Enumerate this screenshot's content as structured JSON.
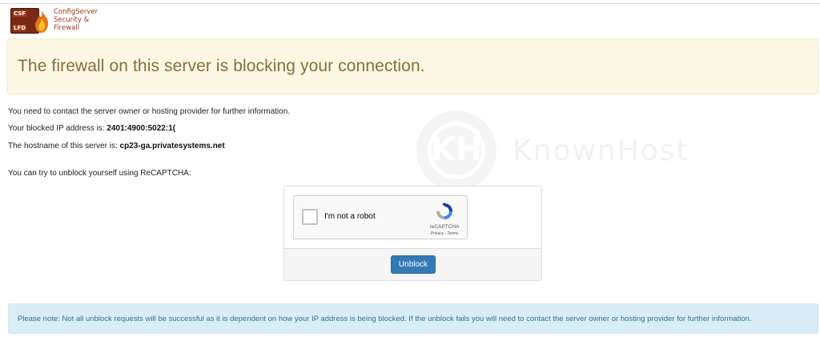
{
  "logo": {
    "box_tag_top": "CSF",
    "box_tag_bottom": "LFD",
    "line1": "ConfigServer",
    "line2": "Security &",
    "line3": "Firewall"
  },
  "banner": {
    "heading": "The firewall on this server is blocking your connection."
  },
  "content": {
    "contact_text": "You need to contact the server owner or hosting provider for further information.",
    "ip_label": "Your blocked IP address is: ",
    "ip_value": "2401:4900:5022:1(",
    "hostname_label": "The hostname of this server is: ",
    "hostname_value": "cp23-ga.privatesystems.net",
    "unblock_prompt": "You can try to unblock yourself using ReCAPTCHA:"
  },
  "watermark": {
    "mark": "KH",
    "text": "KnownHost"
  },
  "recaptcha": {
    "checkbox_label": "I'm not a robot",
    "brand": "reCAPTCHA",
    "terms": "Privacy - Terms"
  },
  "unblock_button": {
    "label": "Unblock"
  },
  "note": {
    "text": "Please note: Not all unblock requests will be successful as it is dependent on how your IP address is being blocked. If the unblock fails you will need to contact the server owner or hosting provider for further information."
  },
  "colors": {
    "warning_bg": "#fcf8e3",
    "warning_text": "#8a6d3b",
    "info_bg": "#d9edf7",
    "info_text": "#31708f",
    "button_primary": "#337ab7"
  }
}
